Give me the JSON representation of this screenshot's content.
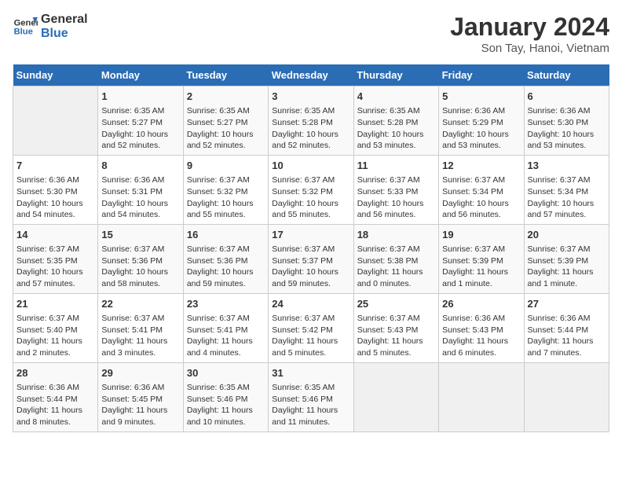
{
  "logo": {
    "line1": "General",
    "line2": "Blue"
  },
  "title": "January 2024",
  "subtitle": "Son Tay, Hanoi, Vietnam",
  "days_of_week": [
    "Sunday",
    "Monday",
    "Tuesday",
    "Wednesday",
    "Thursday",
    "Friday",
    "Saturday"
  ],
  "weeks": [
    [
      {
        "num": "",
        "details": ""
      },
      {
        "num": "1",
        "details": "Sunrise: 6:35 AM\nSunset: 5:27 PM\nDaylight: 10 hours\nand 52 minutes."
      },
      {
        "num": "2",
        "details": "Sunrise: 6:35 AM\nSunset: 5:27 PM\nDaylight: 10 hours\nand 52 minutes."
      },
      {
        "num": "3",
        "details": "Sunrise: 6:35 AM\nSunset: 5:28 PM\nDaylight: 10 hours\nand 52 minutes."
      },
      {
        "num": "4",
        "details": "Sunrise: 6:35 AM\nSunset: 5:28 PM\nDaylight: 10 hours\nand 53 minutes."
      },
      {
        "num": "5",
        "details": "Sunrise: 6:36 AM\nSunset: 5:29 PM\nDaylight: 10 hours\nand 53 minutes."
      },
      {
        "num": "6",
        "details": "Sunrise: 6:36 AM\nSunset: 5:30 PM\nDaylight: 10 hours\nand 53 minutes."
      }
    ],
    [
      {
        "num": "7",
        "details": "Sunrise: 6:36 AM\nSunset: 5:30 PM\nDaylight: 10 hours\nand 54 minutes."
      },
      {
        "num": "8",
        "details": "Sunrise: 6:36 AM\nSunset: 5:31 PM\nDaylight: 10 hours\nand 54 minutes."
      },
      {
        "num": "9",
        "details": "Sunrise: 6:37 AM\nSunset: 5:32 PM\nDaylight: 10 hours\nand 55 minutes."
      },
      {
        "num": "10",
        "details": "Sunrise: 6:37 AM\nSunset: 5:32 PM\nDaylight: 10 hours\nand 55 minutes."
      },
      {
        "num": "11",
        "details": "Sunrise: 6:37 AM\nSunset: 5:33 PM\nDaylight: 10 hours\nand 56 minutes."
      },
      {
        "num": "12",
        "details": "Sunrise: 6:37 AM\nSunset: 5:34 PM\nDaylight: 10 hours\nand 56 minutes."
      },
      {
        "num": "13",
        "details": "Sunrise: 6:37 AM\nSunset: 5:34 PM\nDaylight: 10 hours\nand 57 minutes."
      }
    ],
    [
      {
        "num": "14",
        "details": "Sunrise: 6:37 AM\nSunset: 5:35 PM\nDaylight: 10 hours\nand 57 minutes."
      },
      {
        "num": "15",
        "details": "Sunrise: 6:37 AM\nSunset: 5:36 PM\nDaylight: 10 hours\nand 58 minutes."
      },
      {
        "num": "16",
        "details": "Sunrise: 6:37 AM\nSunset: 5:36 PM\nDaylight: 10 hours\nand 59 minutes."
      },
      {
        "num": "17",
        "details": "Sunrise: 6:37 AM\nSunset: 5:37 PM\nDaylight: 10 hours\nand 59 minutes."
      },
      {
        "num": "18",
        "details": "Sunrise: 6:37 AM\nSunset: 5:38 PM\nDaylight: 11 hours\nand 0 minutes."
      },
      {
        "num": "19",
        "details": "Sunrise: 6:37 AM\nSunset: 5:39 PM\nDaylight: 11 hours\nand 1 minute."
      },
      {
        "num": "20",
        "details": "Sunrise: 6:37 AM\nSunset: 5:39 PM\nDaylight: 11 hours\nand 1 minute."
      }
    ],
    [
      {
        "num": "21",
        "details": "Sunrise: 6:37 AM\nSunset: 5:40 PM\nDaylight: 11 hours\nand 2 minutes."
      },
      {
        "num": "22",
        "details": "Sunrise: 6:37 AM\nSunset: 5:41 PM\nDaylight: 11 hours\nand 3 minutes."
      },
      {
        "num": "23",
        "details": "Sunrise: 6:37 AM\nSunset: 5:41 PM\nDaylight: 11 hours\nand 4 minutes."
      },
      {
        "num": "24",
        "details": "Sunrise: 6:37 AM\nSunset: 5:42 PM\nDaylight: 11 hours\nand 5 minutes."
      },
      {
        "num": "25",
        "details": "Sunrise: 6:37 AM\nSunset: 5:43 PM\nDaylight: 11 hours\nand 5 minutes."
      },
      {
        "num": "26",
        "details": "Sunrise: 6:36 AM\nSunset: 5:43 PM\nDaylight: 11 hours\nand 6 minutes."
      },
      {
        "num": "27",
        "details": "Sunrise: 6:36 AM\nSunset: 5:44 PM\nDaylight: 11 hours\nand 7 minutes."
      }
    ],
    [
      {
        "num": "28",
        "details": "Sunrise: 6:36 AM\nSunset: 5:44 PM\nDaylight: 11 hours\nand 8 minutes."
      },
      {
        "num": "29",
        "details": "Sunrise: 6:36 AM\nSunset: 5:45 PM\nDaylight: 11 hours\nand 9 minutes."
      },
      {
        "num": "30",
        "details": "Sunrise: 6:35 AM\nSunset: 5:46 PM\nDaylight: 11 hours\nand 10 minutes."
      },
      {
        "num": "31",
        "details": "Sunrise: 6:35 AM\nSunset: 5:46 PM\nDaylight: 11 hours\nand 11 minutes."
      },
      {
        "num": "",
        "details": ""
      },
      {
        "num": "",
        "details": ""
      },
      {
        "num": "",
        "details": ""
      }
    ]
  ]
}
